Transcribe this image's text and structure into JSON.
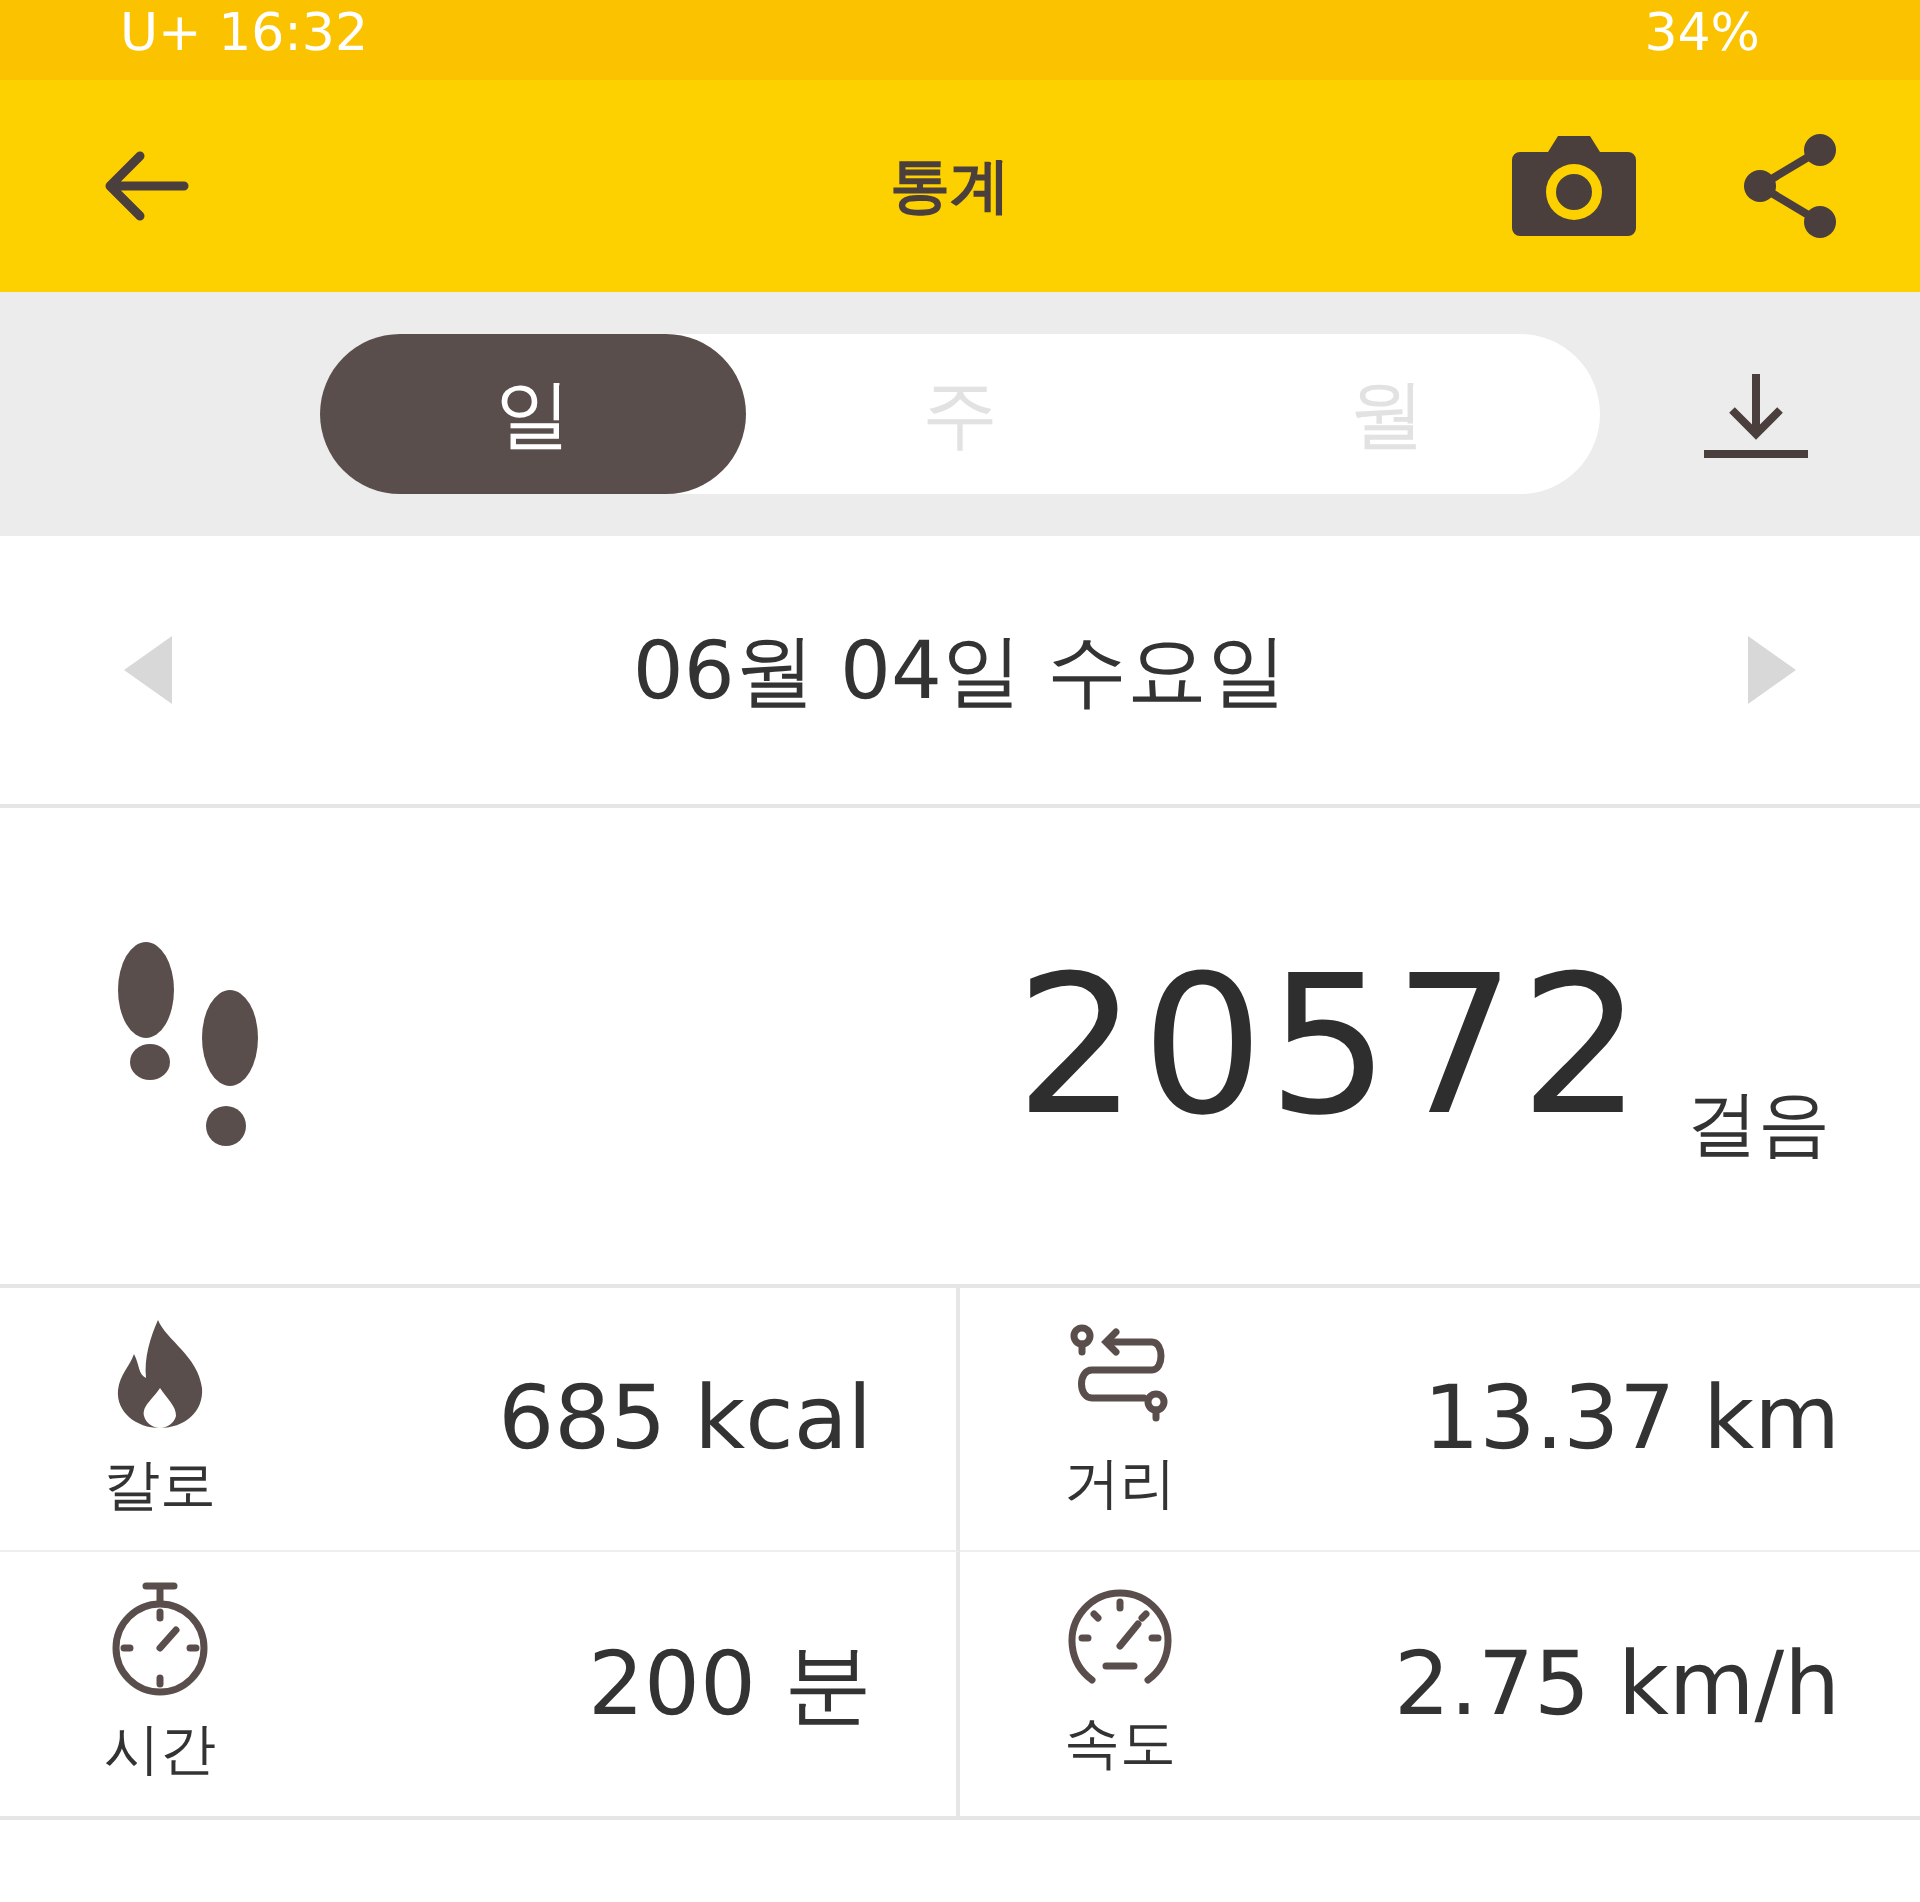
{
  "status_bar": {
    "carrier_time": "U+ 16:32",
    "battery": "34%"
  },
  "app_bar": {
    "title": "통계"
  },
  "tabs": [
    {
      "label": "일",
      "selected": true
    },
    {
      "label": "주",
      "selected": false
    },
    {
      "label": "월",
      "selected": false
    }
  ],
  "date_nav": {
    "date": "06월 04일 수요일"
  },
  "steps": {
    "value": "20572",
    "unit": "걸음"
  },
  "stats": [
    {
      "kind": "calories",
      "label": "칼로",
      "value": "685 kcal"
    },
    {
      "kind": "distance",
      "label": "거리",
      "value": "13.37 km"
    },
    {
      "kind": "time",
      "label": "시간",
      "value": "200 분"
    },
    {
      "kind": "speed",
      "label": "속도",
      "value": "2.75 km/h"
    }
  ]
}
